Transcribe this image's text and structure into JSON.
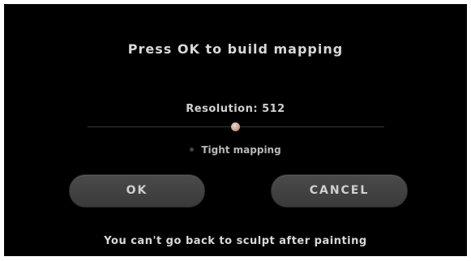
{
  "dialog": {
    "title": "Press OK to build mapping",
    "resolution_label": "Resolution: 512",
    "resolution_value": 512,
    "option_label": "Tight mapping",
    "option_checked": false,
    "ok_label": "OK",
    "cancel_label": "CANCEL",
    "warning": "You can't go back to sculpt after painting"
  },
  "colors": {
    "background": "#000000",
    "text": "#d8d8d8",
    "button": "#424242",
    "slider_thumb": "#c79e8c"
  }
}
